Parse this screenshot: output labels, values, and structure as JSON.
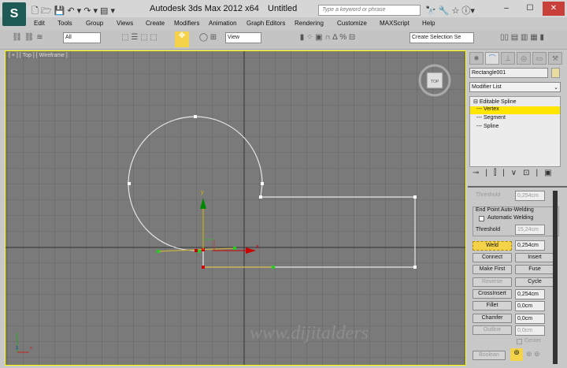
{
  "titlebar": {
    "app_title": "Autodesk 3ds Max  2012 x64",
    "document": "Untitled",
    "search_placeholder": "Type a keyword or phrase",
    "minimize": "–",
    "maximize": "☐",
    "close": "✕"
  },
  "menu": [
    "Edit",
    "Tools",
    "Group",
    "Views",
    "Create",
    "Modifiers",
    "Animation",
    "Graph Editors",
    "Rendering",
    "Customize",
    "MAXScript",
    "Help"
  ],
  "toolbar": {
    "selection_filter": "All",
    "reference_coord": "View",
    "named_selection": "Create Selection Se"
  },
  "viewport": {
    "label": "[ + ] [ Top ] [ Wireframe ]",
    "viewcube": "TOP",
    "gizmo_x": "x",
    "gizmo_y": "y",
    "watermark": "www.dijitalders",
    "axis_x": "x",
    "axis_y": "y",
    "axis_z": "z"
  },
  "panel": {
    "object_name": "Rectangle001",
    "object_color": "#e8dca0",
    "modifier_list": "Modifier List",
    "stack": {
      "root": "Editable Spline",
      "items": [
        "Vertex",
        "Segment",
        "Spline"
      ],
      "selected": "Vertex"
    },
    "threshold_top_label": "Threshold",
    "threshold_top_value": "0,254cm",
    "autoweld_group": "End Point Auto-Welding",
    "automatic_welding": "Automatic Welding",
    "automatic_welding_checked": false,
    "threshold_label": "Threshold",
    "threshold_value": "15,24cm",
    "weld": "Weld",
    "weld_value": "0,254cm",
    "connect": "Connect",
    "insert": "Insert",
    "make_first": "Make First",
    "fuse": "Fuse",
    "reverse": "Reverse",
    "cycle": "Cycle",
    "crossinsert": "CrossInsert",
    "crossinsert_value": "0,254cm",
    "fillet": "Fillet",
    "fillet_value": "0,0cm",
    "chamfer": "Chamfer",
    "chamfer_value": "0,0cm",
    "outline": "Outline",
    "outline_value": "0,0cm",
    "center": "Center",
    "boolean": "Boolean"
  },
  "colors": {
    "accent": "#ffe600",
    "viewport_bg": "#7a7a7a",
    "active_border": "#ffff00"
  }
}
